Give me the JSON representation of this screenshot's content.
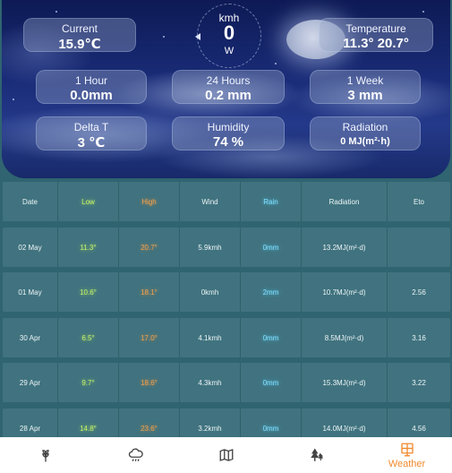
{
  "current": {
    "label": "Current",
    "value": "15.9℃"
  },
  "temperature": {
    "label": "Temperature",
    "value": "11.3° 20.7°"
  },
  "wind": {
    "unit": "kmh",
    "speed": "0",
    "direction": "W"
  },
  "rain_1h": {
    "label": "1 Hour",
    "value": "0.0mm"
  },
  "rain_24h": {
    "label": "24 Hours",
    "value": "0.2 mm"
  },
  "rain_1w": {
    "label": "1 Week",
    "value": "3 mm"
  },
  "delta_t": {
    "label": "Delta T",
    "value": "3 ℃"
  },
  "humidity": {
    "label": "Humidity",
    "value": "74 %"
  },
  "radiation": {
    "label": "Radiation",
    "value": "0 MJ(m²·h)"
  },
  "table": {
    "headers": [
      "Date",
      "Low",
      "High",
      "Wind",
      "Rain",
      "Radiation",
      "Eto"
    ],
    "rows": [
      {
        "date": "02 May",
        "low": "11.3°",
        "high": "20.7°",
        "wind": "5.9kmh",
        "rain": "0mm",
        "radiation": "13.2MJ(m²·d)",
        "eto": ""
      },
      {
        "date": "01 May",
        "low": "10.6°",
        "high": "18.1°",
        "wind": "0kmh",
        "rain": "2mm",
        "radiation": "10.7MJ(m²·d)",
        "eto": "2.56"
      },
      {
        "date": "30 Apr",
        "low": "6.5°",
        "high": "17.0°",
        "wind": "4.1kmh",
        "rain": "0mm",
        "radiation": "8.5MJ(m²·d)",
        "eto": "3.16"
      },
      {
        "date": "29 Apr",
        "low": "9.7°",
        "high": "18.6°",
        "wind": "4.3kmh",
        "rain": "0mm",
        "radiation": "15.3MJ(m²·d)",
        "eto": "3.22"
      },
      {
        "date": "28 Apr",
        "low": "14.8°",
        "high": "23.6°",
        "wind": "3.2kmh",
        "rain": "0mm",
        "radiation": "14.0MJ(m²·d)",
        "eto": "4.56"
      }
    ]
  },
  "nav": {
    "items": [
      {
        "icon": "wheat-icon",
        "label": ""
      },
      {
        "icon": "rain-cloud-icon",
        "label": ""
      },
      {
        "icon": "map-icon",
        "label": ""
      },
      {
        "icon": "tree-icon",
        "label": ""
      },
      {
        "icon": "weather-station-icon",
        "label": "Weather"
      }
    ],
    "active_color": "#f28a2e"
  }
}
